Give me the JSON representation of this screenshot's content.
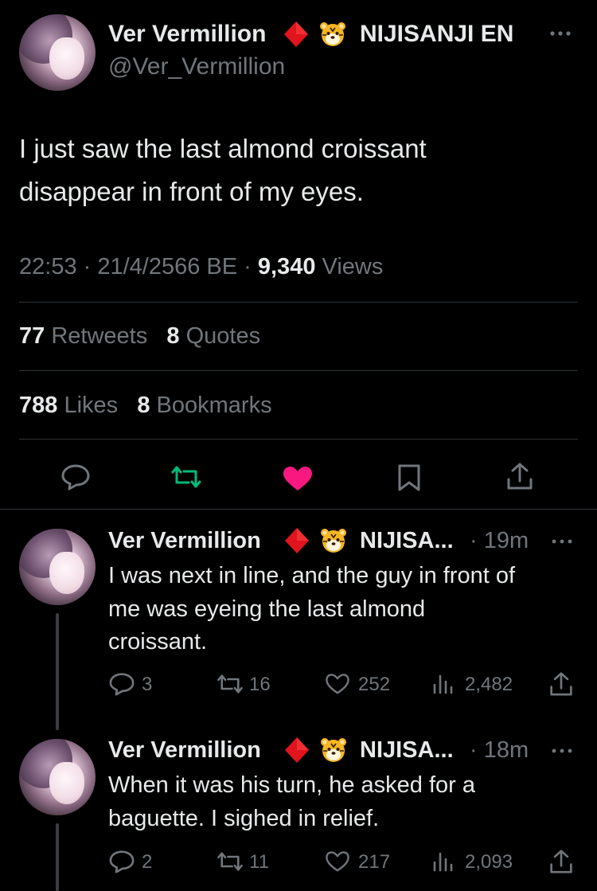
{
  "main_tweet": {
    "author_name": "Ver Vermillion",
    "affiliation": "NIJISANJI EN",
    "handle": "@Ver_Vermillion",
    "text_line1": "I just saw the last almond croissant",
    "text_line2": "disappear in front of my eyes.",
    "time": "22:53 · 21/4/2566 BE ·",
    "views_count": "9,340",
    "views_label": "Views",
    "retweets_count": "77",
    "retweets_label": "Retweets",
    "quotes_count": "8",
    "quotes_label": "Quotes",
    "likes_count": "788",
    "likes_label": "Likes",
    "bookmarks_count": "8",
    "bookmarks_label": "Bookmarks"
  },
  "replies": [
    {
      "author_name": "Ver Vermillion",
      "affiliation": "NIJISA...",
      "time": "· 19m",
      "text_lines": [
        "I was next in line, and the guy in front of",
        "me was eyeing the last almond",
        "croissant."
      ],
      "replies": "3",
      "retweets": "16",
      "likes": "252",
      "views": "2,482"
    },
    {
      "author_name": "Ver Vermillion",
      "affiliation": "NIJISA...",
      "time": "· 18m",
      "text_lines": [
        "When it was his turn, he asked for a",
        "baguette. I sighed in relief."
      ],
      "replies": "2",
      "retweets": "11",
      "likes": "217",
      "views": "2,093"
    }
  ],
  "colors": {
    "background": "#000000",
    "text": "#e7e9ea",
    "muted": "#71767b",
    "retweet_green": "#00ba7c",
    "like_pink": "#f91880",
    "diamond_red": "#e0141d",
    "divider": "#2f3336"
  },
  "icons": [
    "more-icon",
    "reply-icon",
    "retweet-icon",
    "like-icon",
    "bookmark-icon",
    "share-icon",
    "views-icon",
    "diamond-icon",
    "tiger-emoji-icon"
  ]
}
